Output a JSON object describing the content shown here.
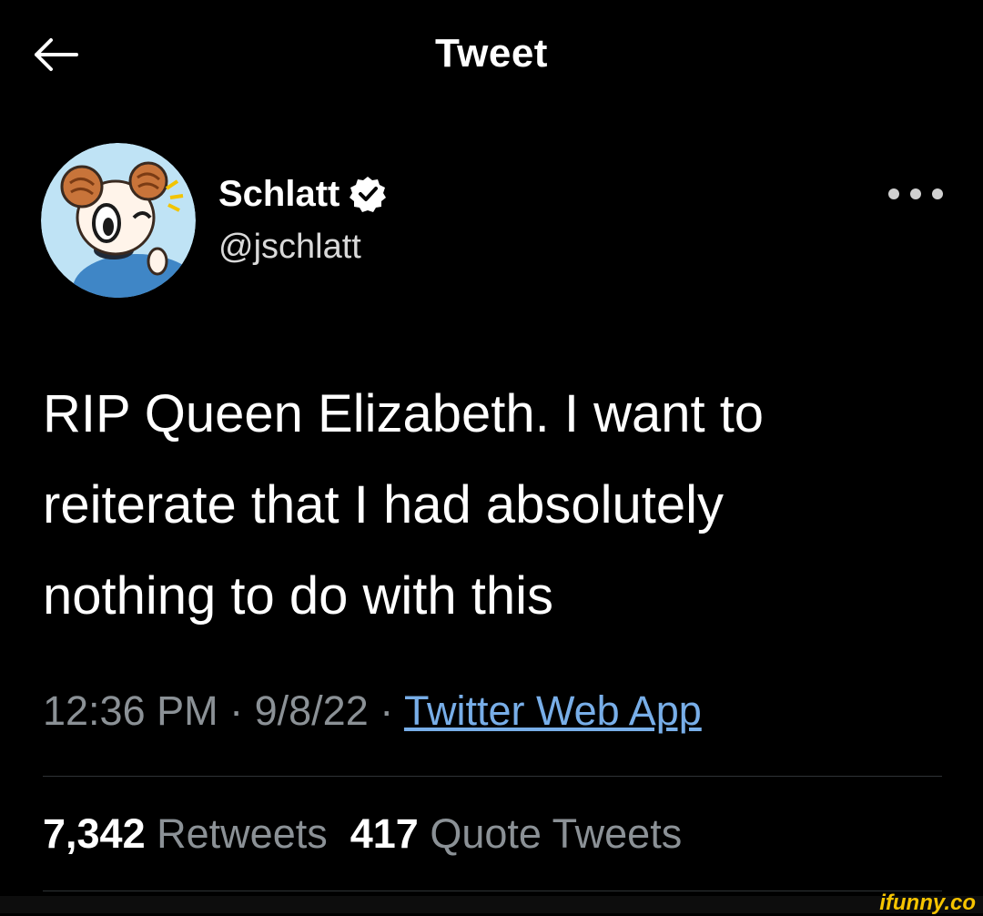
{
  "header": {
    "title": "Tweet",
    "back_icon": "arrow-left-icon"
  },
  "author": {
    "display_name": "Schlatt",
    "handle": "@jschlatt",
    "verified_icon": "verified-badge-icon"
  },
  "more_icon": "more-horizontal-icon",
  "tweet": {
    "line1": "RIP Queen Elizabeth. I want to",
    "line2": "reiterate that I had absolutely",
    "line3": "nothing to do with this"
  },
  "meta": {
    "time": "12:36 PM",
    "sep1": " · ",
    "date": "9/8/22",
    "sep2": " · ",
    "source": "Twitter Web App"
  },
  "stats": {
    "retweets_count": "7,342",
    "retweets_label": "Retweets",
    "quotes_count": "417",
    "quotes_label": "Quote Tweets"
  },
  "watermark": "ifunny.co",
  "colors": {
    "background": "#000000",
    "text": "#ffffff",
    "muted": "#8b9196",
    "link": "#78aee8",
    "watermark": "#f6c400"
  }
}
